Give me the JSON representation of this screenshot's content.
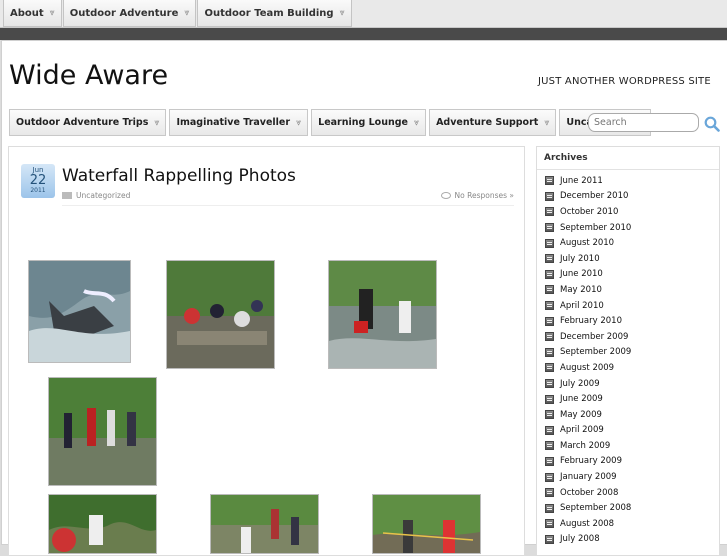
{
  "top_nav": [
    {
      "label": "About"
    },
    {
      "label": "Outdoor Adventure"
    },
    {
      "label": "Outdoor Team Building"
    }
  ],
  "site": {
    "title": "Wide Aware",
    "tagline": "JUST ANOTHER WORDPRESS SITE"
  },
  "main_nav": [
    {
      "label": "Outdoor Adventure Trips",
      "has_dropdown": true
    },
    {
      "label": "Imaginative Traveller",
      "has_dropdown": true
    },
    {
      "label": "Learning Lounge",
      "has_dropdown": true
    },
    {
      "label": "Adventure Support",
      "has_dropdown": true
    },
    {
      "label": "Uncategorized",
      "has_dropdown": false
    }
  ],
  "search": {
    "placeholder": "Search",
    "icon": "magnifier-icon"
  },
  "post": {
    "date": {
      "month": "Jun",
      "day": "22",
      "year": "2011"
    },
    "title": "Waterfall Rappelling Photos",
    "category": "Uncategorized",
    "responses": "No Responses »",
    "photos": [
      {
        "name": "photo-waterfall-rappel"
      },
      {
        "name": "photo-group-rocks"
      },
      {
        "name": "photo-stream-crossing"
      },
      {
        "name": "photo-group-forest"
      },
      {
        "name": "photo-climbing-rope"
      },
      {
        "name": "photo-hikers-trail"
      },
      {
        "name": "photo-rappel-instructor"
      }
    ]
  },
  "sidebar": {
    "heading": "Archives",
    "items": [
      "June 2011",
      "December 2010",
      "October 2010",
      "September 2010",
      "August 2010",
      "July 2010",
      "June 2010",
      "May 2010",
      "April 2010",
      "February 2010",
      "December 2009",
      "September 2009",
      "August 2009",
      "July 2009",
      "June 2009",
      "May 2009",
      "April 2009",
      "March 2009",
      "February 2009",
      "January 2009",
      "October 2008",
      "September 2008",
      "August 2008",
      "July 2008"
    ]
  },
  "colors": {
    "accent": "#4a90d9",
    "dark_band": "#4a4a4a"
  }
}
